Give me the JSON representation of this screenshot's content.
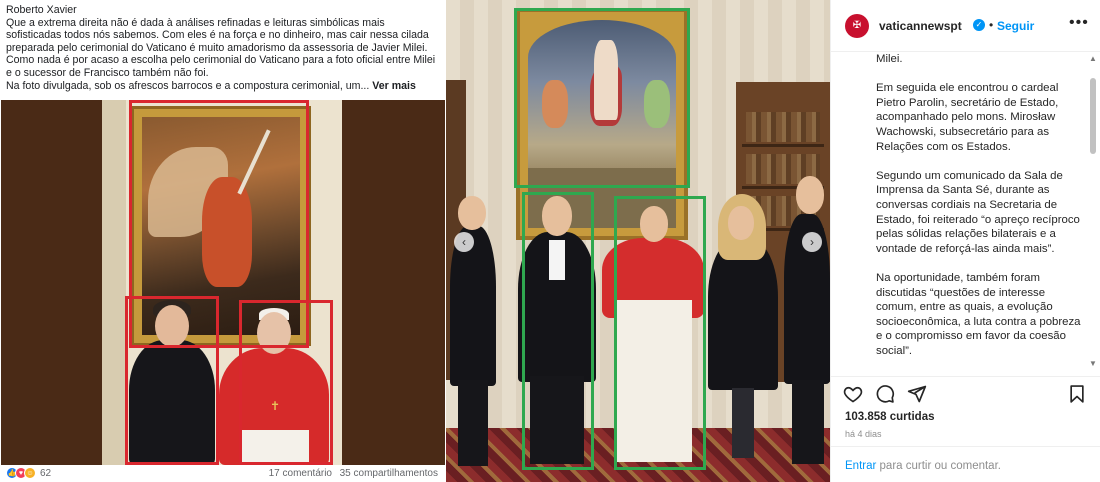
{
  "facebook_post": {
    "author": "Roberto Xavier",
    "body_lines": [
      "Que a extrema direita não é dada à análises refinadas e leituras simbólicas mais sofisticadas todos nós sabemos. Com eles é na força e no dinheiro, mas cair nessa cilada preparada pelo cerimonial do Vaticano é muito amadorismo da assessoria de Javier Milei.",
      "Como nada é por acaso a escolha pelo cerimonial do Vaticano para a foto oficial entre Milei e o sucessor de Francisco também não foi."
    ],
    "last_line": "Na foto divulgada, sob os afrescos barrocos e a compostura cerimonial, um...",
    "see_more": "Ver mais",
    "reaction_count": "62",
    "comments": "17 comentário",
    "shares": "35 compartilhamentos",
    "colors": {
      "highlight_box": "#d9272e",
      "like": "#1877f2",
      "love": "#f33e58",
      "haha": "#f7b125"
    }
  },
  "photo": {
    "colors": {
      "highlight_box": "#2fa84f"
    }
  },
  "instagram": {
    "username": "vaticannewspt",
    "separator": "•",
    "follow_label": "Seguir",
    "more_icon": "ellipsis-icon",
    "caption_paragraphs": [
      "Milei.",
      "Em seguida ele encontrou o cardeal Pietro Parolin, secretário de Estado, acompanhado pelo mons. Mirosław Wachowski, subsecretário para as Relações com os Estados.",
      "Segundo um comunicado da Sala de Imprensa da Santa Sé, durante as conversas cordiais na Secretaria de Estado, foi reiterado “o apreço recíproco pelas sólidas relações bilaterais e a vontade de reforçá-las ainda mais”.",
      "Na oportunidade, também foram discutidas “questões de interesse comum, entre as quais, a evolução socioeconômica, a luta contra a pobreza e o compromisso em favor da coesão social”."
    ],
    "actions": [
      "heart-icon",
      "comment-icon",
      "share-icon",
      "bookmark-icon"
    ],
    "likes": "103.858 curtidas",
    "time": "há 4 dias",
    "login_link": "Entrar",
    "login_rest": " para curtir ou comentar.",
    "colors": {
      "brand": "#c8102e",
      "link": "#0095f6",
      "verified": "#0095f6"
    }
  }
}
